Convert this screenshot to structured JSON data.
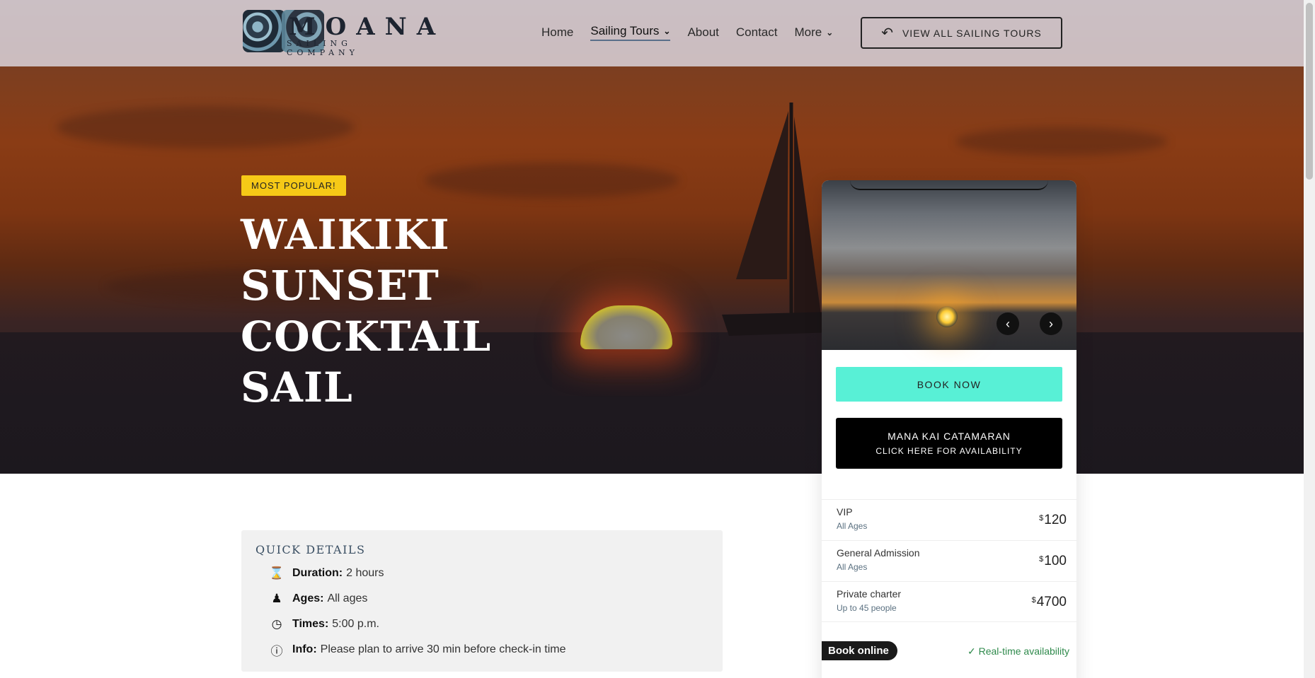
{
  "header": {
    "logo_name": "MOANA",
    "logo_sub": "SAILING COMPANY",
    "nav": [
      {
        "label": "Home"
      },
      {
        "label": "Sailing Tours"
      },
      {
        "label": "About"
      },
      {
        "label": "Contact"
      },
      {
        "label": "More"
      }
    ],
    "view_all_label": "VIEW ALL SAILING TOURS"
  },
  "hero": {
    "badge": "MOST POPULAR!",
    "title_line1": "WAIKIKI",
    "title_line2": "SUNSET COCKTAIL",
    "title_line3": "SAIL"
  },
  "booking": {
    "book_now": "BOOK NOW",
    "availability_line1": "MANA KAI CATAMARAN",
    "availability_line2": "CLICK HERE FOR AVAILABILITY",
    "prices": [
      {
        "name": "VIP",
        "note": "All Ages",
        "currency": "$",
        "amount": "120"
      },
      {
        "name": "General Admission",
        "note": "All Ages",
        "currency": "$",
        "amount": "100"
      },
      {
        "name": "Private charter",
        "note": "Up to 45 people",
        "currency": "$",
        "amount": "4700"
      }
    ],
    "book_online": "Book online",
    "realtime": "Real-time availability"
  },
  "quick_details": {
    "title": "QUICK DETAILS",
    "rows": [
      {
        "label": "Duration:",
        "value": "2 hours",
        "icon": "hourglass-icon"
      },
      {
        "label": "Ages:",
        "value": "All ages",
        "icon": "person-icon"
      },
      {
        "label": "Times:",
        "value": "5:00 p.m.",
        "icon": "clock-icon"
      },
      {
        "label": "Info:",
        "value": "Please plan to arrive 30 min before check-in time",
        "icon": "info-icon"
      }
    ]
  },
  "colors": {
    "accent_teal": "#58f0d6",
    "badge_yellow": "#f6c917",
    "availability_green": "#2f8a4c"
  }
}
